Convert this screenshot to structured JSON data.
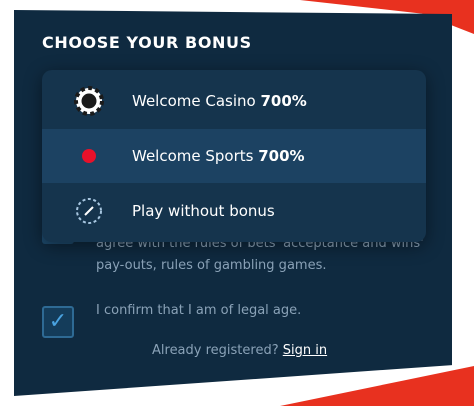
{
  "header": {
    "title": "CHOOSE YOUR BONUS"
  },
  "bonus_options": [
    {
      "label": "Welcome Casino",
      "percent": "700%",
      "icon": "casino-chip-icon"
    },
    {
      "label": "Welcome Sports",
      "percent": "700%",
      "icon": "red-dot-icon",
      "selected": true
    },
    {
      "label": "Play without bonus",
      "percent": "",
      "icon": "no-bonus-icon"
    }
  ],
  "terms": {
    "text": "agree with the rules of bets 'acceptance and wins' pay-outs, rules of gambling games."
  },
  "age": {
    "checked": true,
    "label": "I confirm that I am of legal age."
  },
  "footer": {
    "already_text": "Already registered?",
    "signin_label": "Sign in"
  },
  "colors": {
    "panel": "#0f2a40",
    "accent_red": "#e8311f",
    "dropdown": "#15344d",
    "selected_row": "#1c4262",
    "checkbox_check": "#4aa3e0"
  }
}
